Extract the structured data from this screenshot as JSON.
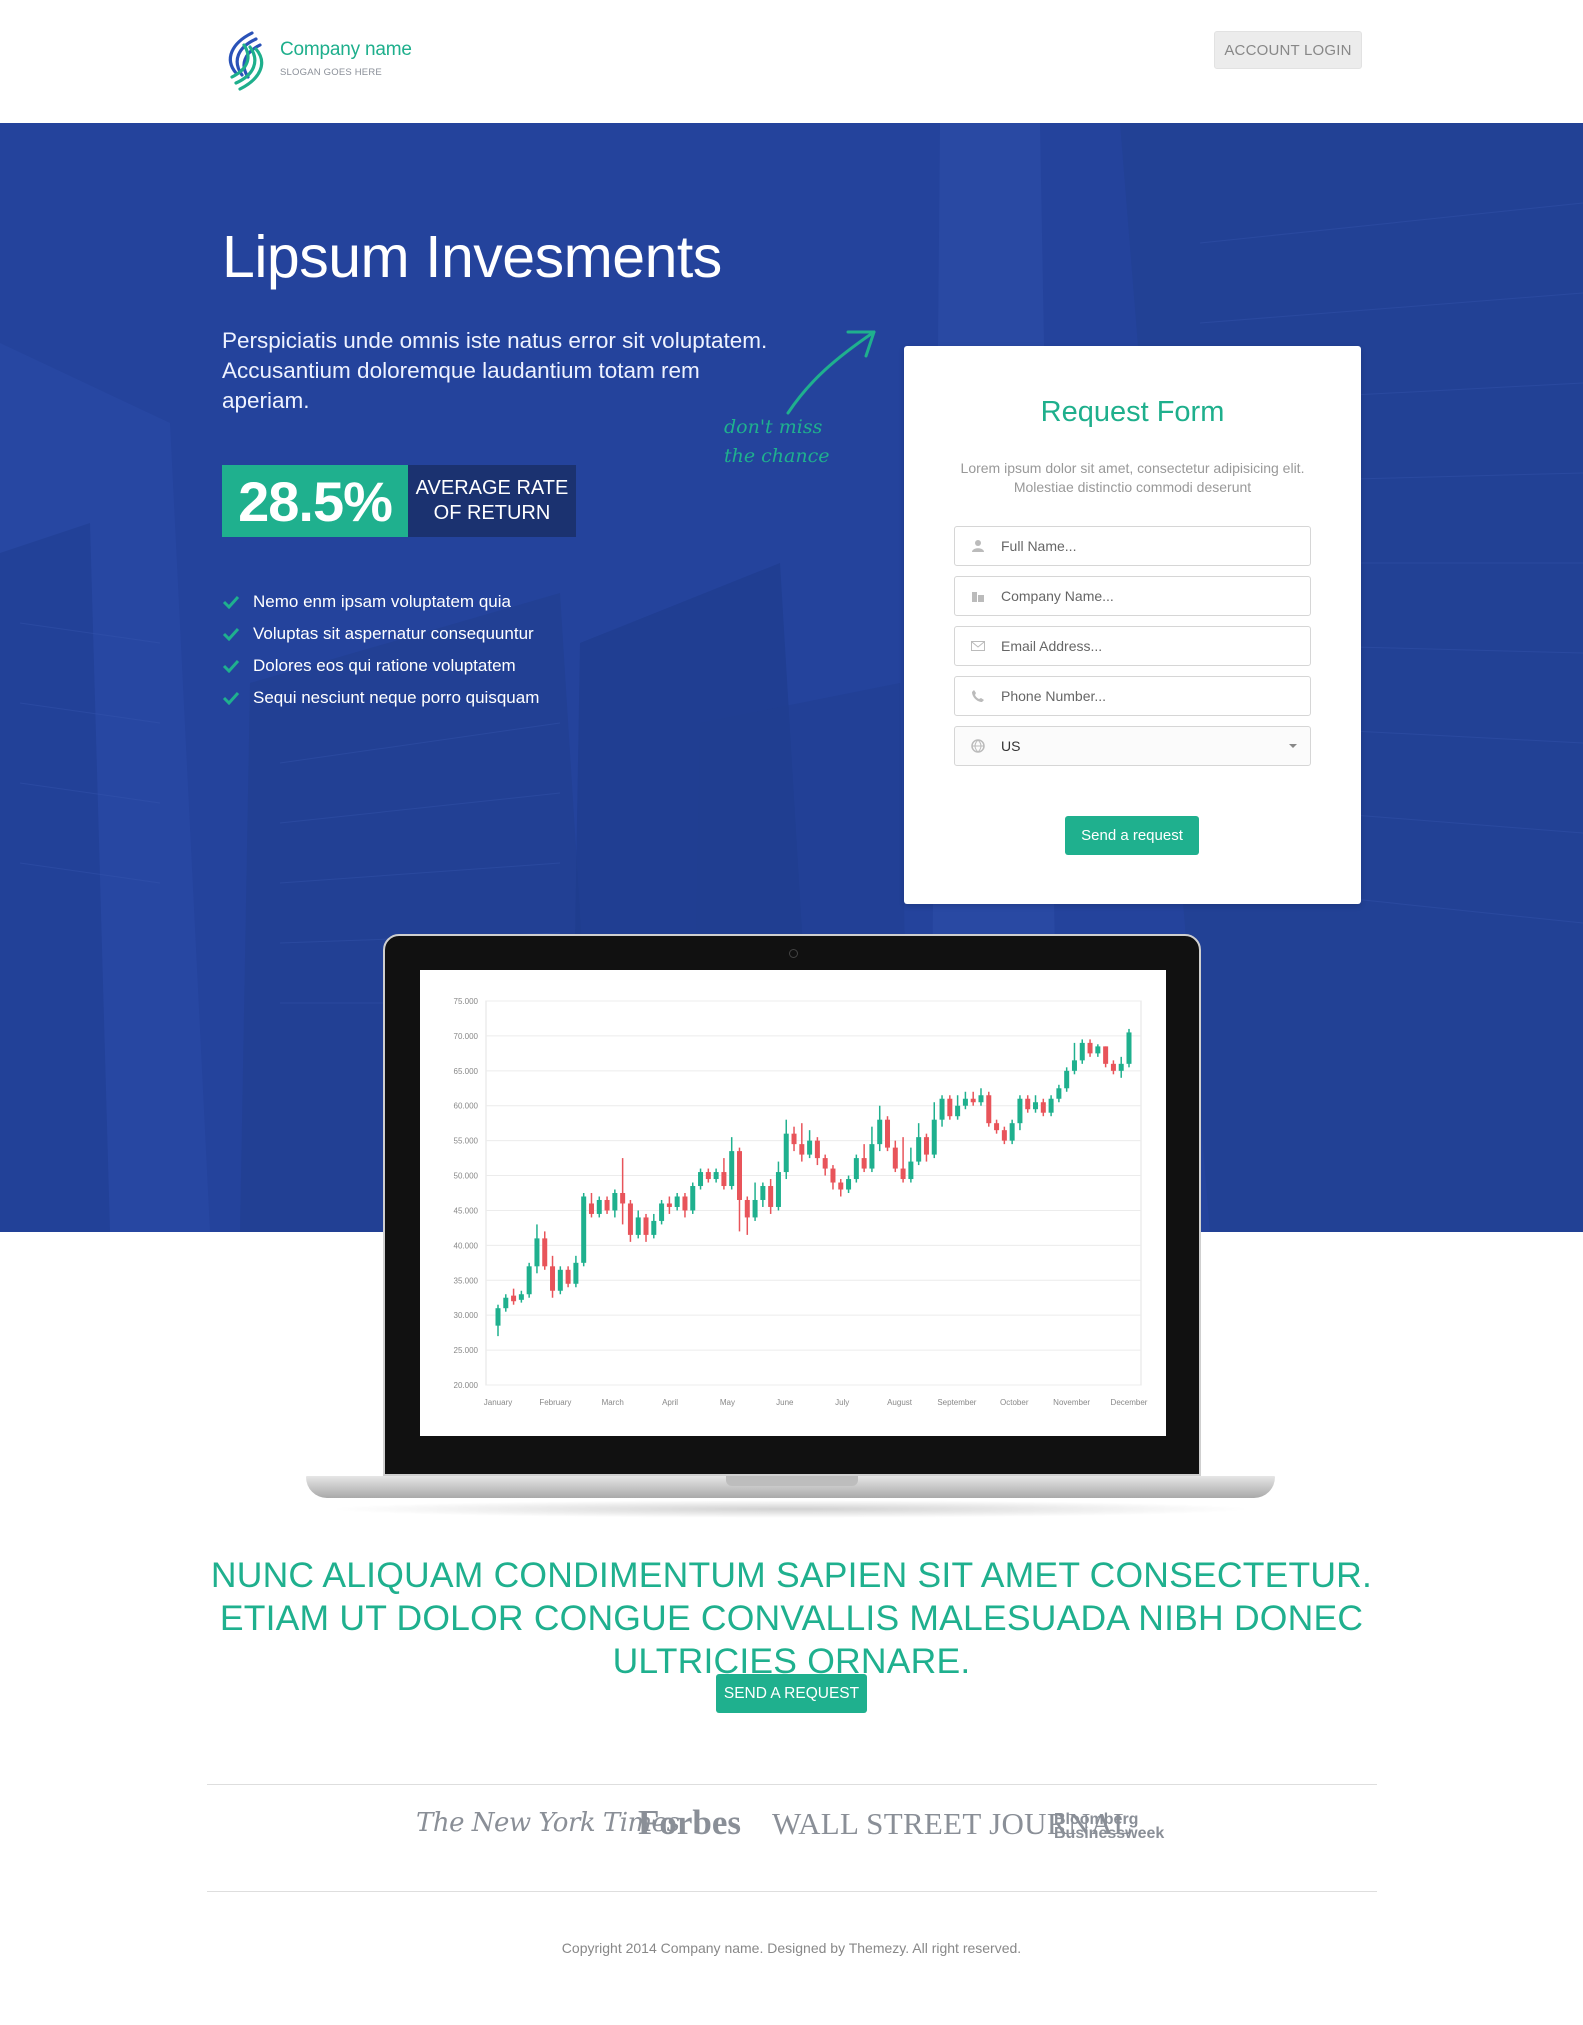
{
  "header": {
    "company_name": "Company name",
    "slogan": "SLOGAN GOES HERE",
    "login_label": "ACCOUNT LOGIN"
  },
  "hero": {
    "title": "Lipsum Invesments",
    "subtitle": "Perspiciatis unde omnis iste natus error sit voluptatem. Accusantium doloremque laudantium totam rem aperiam.",
    "stat_value": "28.5%",
    "stat_label": "AVERAGE RATE OF RETURN",
    "features": [
      "Nemo enm ipsam voluptatem quia",
      "Voluptas sit aspernatur consequuntur",
      "Dolores eos qui ratione voluptatem",
      "Sequi nesciunt neque porro quisquam"
    ],
    "handwritten_line1": "don't miss",
    "handwritten_line2": "the chance"
  },
  "form": {
    "title": "Request Form",
    "description": "Lorem ipsum dolor sit amet, consectetur adipisicing elit. Molestiae distinctio commodi deserunt",
    "fields": [
      {
        "placeholder": "Full Name...",
        "icon": "user-icon"
      },
      {
        "placeholder": "Company Name...",
        "icon": "building-icon"
      },
      {
        "placeholder": "Email Address...",
        "icon": "envelope-icon"
      },
      {
        "placeholder": "Phone Number...",
        "icon": "phone-icon"
      }
    ],
    "country": {
      "value": "US",
      "icon": "globe-icon"
    },
    "submit_label": "Send a request"
  },
  "chart_data": {
    "type": "candlestick",
    "title": "",
    "xlabel": "",
    "ylabel": "",
    "ylim": [
      20000,
      75000
    ],
    "yticks": [
      "75.000",
      "70.000",
      "65.000",
      "60.000",
      "55.000",
      "50.000",
      "45.000",
      "40.000",
      "35.000",
      "30.000",
      "25.000",
      "20.000"
    ],
    "categories": [
      "January",
      "February",
      "March",
      "April",
      "May",
      "June",
      "July",
      "August",
      "September",
      "October",
      "November",
      "December"
    ],
    "colors": {
      "up": "#1fb08e",
      "down": "#e8545a"
    },
    "values": [
      [
        28500,
        31000,
        27000,
        31500
      ],
      [
        31000,
        32500,
        30500,
        33000
      ],
      [
        32800,
        32000,
        31500,
        33800
      ],
      [
        32200,
        33000,
        31800,
        33500
      ],
      [
        33000,
        37000,
        32500,
        37500
      ],
      [
        37000,
        41000,
        36000,
        43000
      ],
      [
        41000,
        37000,
        36500,
        42000
      ],
      [
        37000,
        33500,
        32500,
        38500
      ],
      [
        33500,
        36500,
        33000,
        37000
      ],
      [
        36500,
        34500,
        34000,
        37000
      ],
      [
        34500,
        37500,
        34000,
        38500
      ],
      [
        37500,
        47000,
        37000,
        47500
      ],
      [
        46000,
        44500,
        44000,
        47500
      ],
      [
        44500,
        46500,
        44000,
        47000
      ],
      [
        46500,
        45000,
        44500,
        47000
      ],
      [
        45000,
        47500,
        44000,
        48000
      ],
      [
        47500,
        46000,
        43000,
        52500
      ],
      [
        46000,
        41500,
        40500,
        46500
      ],
      [
        41500,
        44000,
        41000,
        45000
      ],
      [
        44000,
        41500,
        40500,
        44500
      ],
      [
        41500,
        43500,
        41000,
        44500
      ],
      [
        43500,
        46000,
        43000,
        46500
      ],
      [
        46000,
        45500,
        44500,
        47000
      ],
      [
        45500,
        47000,
        45000,
        47500
      ],
      [
        47000,
        45000,
        44000,
        47500
      ],
      [
        45000,
        48500,
        44500,
        49000
      ],
      [
        48500,
        50500,
        48000,
        51000
      ],
      [
        50500,
        49500,
        49000,
        51000
      ],
      [
        49500,
        50500,
        49000,
        51000
      ],
      [
        50500,
        48500,
        48000,
        52500
      ],
      [
        48500,
        53500,
        48000,
        55500
      ],
      [
        53500,
        46500,
        42000,
        54000
      ],
      [
        46500,
        44000,
        41500,
        47000
      ],
      [
        44000,
        46500,
        43500,
        49000
      ],
      [
        46500,
        48500,
        45500,
        49000
      ],
      [
        48500,
        45500,
        44500,
        49500
      ],
      [
        45500,
        50500,
        45000,
        52000
      ],
      [
        50500,
        56000,
        49500,
        58000
      ],
      [
        56000,
        54500,
        53500,
        57000
      ],
      [
        54500,
        53000,
        52000,
        57500
      ],
      [
        53000,
        55000,
        52500,
        56500
      ],
      [
        55000,
        52500,
        51500,
        55500
      ],
      [
        52500,
        51000,
        50000,
        53000
      ],
      [
        51000,
        49000,
        48000,
        51500
      ],
      [
        49000,
        48000,
        47000,
        49500
      ],
      [
        48000,
        49500,
        47500,
        50000
      ],
      [
        49500,
        52500,
        49000,
        53000
      ],
      [
        52500,
        51000,
        50500,
        54500
      ],
      [
        51000,
        54500,
        50500,
        57000
      ],
      [
        54500,
        58000,
        53500,
        60000
      ],
      [
        58000,
        54000,
        53500,
        58500
      ],
      [
        54000,
        51000,
        50500,
        55000
      ],
      [
        51000,
        49500,
        49000,
        55500
      ],
      [
        49500,
        52000,
        49000,
        54000
      ],
      [
        52000,
        55500,
        51500,
        57500
      ],
      [
        55500,
        53000,
        52000,
        56000
      ],
      [
        53000,
        58000,
        52500,
        60500
      ],
      [
        58000,
        61000,
        57000,
        61500
      ],
      [
        61000,
        58500,
        58000,
        61500
      ],
      [
        58500,
        60000,
        58000,
        61500
      ],
      [
        60000,
        61000,
        59500,
        62000
      ],
      [
        61000,
        60500,
        60000,
        62000
      ],
      [
        60500,
        61500,
        60000,
        62500
      ],
      [
        61500,
        57500,
        57000,
        62000
      ],
      [
        57500,
        56500,
        56000,
        58000
      ],
      [
        56500,
        55000,
        54500,
        57000
      ],
      [
        55000,
        57500,
        54500,
        58000
      ],
      [
        57500,
        61000,
        56500,
        61500
      ],
      [
        61000,
        59500,
        59000,
        61500
      ],
      [
        59500,
        60500,
        59000,
        61500
      ],
      [
        60500,
        59000,
        58500,
        61000
      ],
      [
        59000,
        61000,
        58500,
        61500
      ],
      [
        61000,
        62500,
        60500,
        63000
      ],
      [
        62500,
        65000,
        62000,
        65500
      ],
      [
        65000,
        66500,
        64500,
        69000
      ],
      [
        66500,
        69000,
        66000,
        69500
      ],
      [
        69000,
        67500,
        67000,
        69500
      ],
      [
        67500,
        68500,
        67000,
        68800
      ],
      [
        68500,
        66000,
        65500,
        68500
      ],
      [
        66000,
        65000,
        64500,
        66500
      ],
      [
        65000,
        66000,
        64000,
        67000
      ],
      [
        66000,
        70500,
        65500,
        71000
      ]
    ]
  },
  "cta": {
    "tagline": "NUNC ALIQUAM CONDIMENTUM SAPIEN SIT AMET CONSECTETUR. ETIAM UT DOLOR CONGUE CONVALLIS MALESUADA NIBH DONEC ULTRICIES ORNARE.",
    "button_label": "SEND A REQUEST"
  },
  "press": {
    "nyt": "The New York Times",
    "forbes": "Forbes",
    "wsj": "WALL STREET JOURNAL",
    "bloomberg_line1": "Bloomberg",
    "bloomberg_line2": "Businessweek"
  },
  "footer": {
    "copyright": "Copyright 2014 Company name. Designed by Themezy. All right reserved."
  }
}
